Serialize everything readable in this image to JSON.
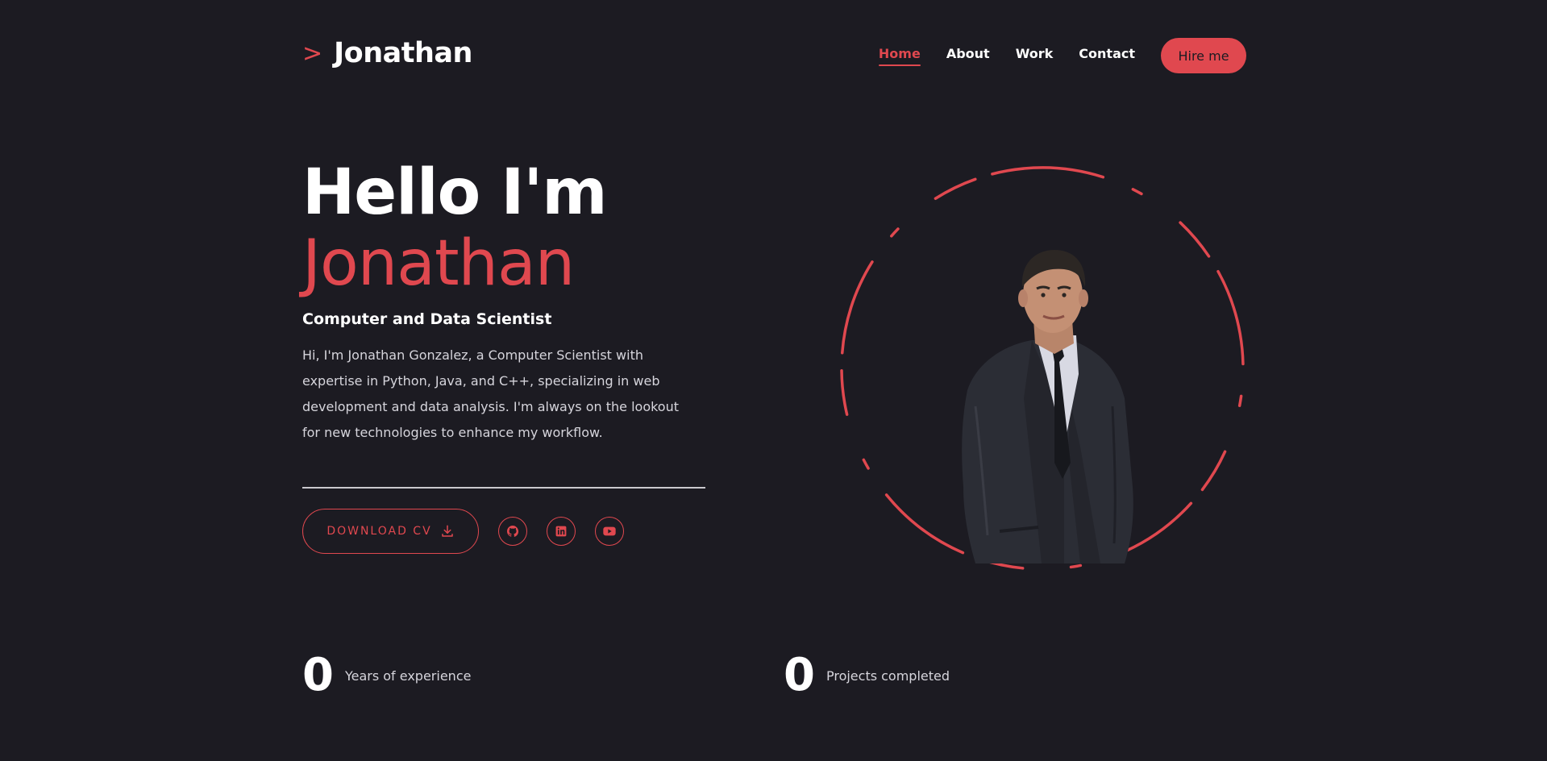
{
  "brand": {
    "chevron": ">",
    "name": "Jonathan"
  },
  "nav": {
    "items": [
      {
        "label": "Home",
        "active": true
      },
      {
        "label": "About",
        "active": false
      },
      {
        "label": "Work",
        "active": false
      },
      {
        "label": "Contact",
        "active": false
      }
    ],
    "cta_label": "Hire me"
  },
  "hero": {
    "greeting": "Hello I'm",
    "name": "Jonathan",
    "role": "Computer and Data Scientist",
    "bio": "Hi, I'm Jonathan Gonzalez, a Computer Scientist with expertise in Python, Java, and C++, specializing in web development and data analysis. I'm always on the lookout for new technologies to enhance my workflow.",
    "download_label": "DOWNLOAD CV",
    "socials": [
      "github-icon",
      "linkedin-icon",
      "youtube-icon"
    ]
  },
  "stats": [
    {
      "value": "0",
      "label": "Years of experience"
    },
    {
      "value": "0",
      "label": "Projects completed"
    }
  ],
  "colors": {
    "background": "#1c1b22",
    "accent": "#e0484f",
    "text": "#ffffff"
  }
}
